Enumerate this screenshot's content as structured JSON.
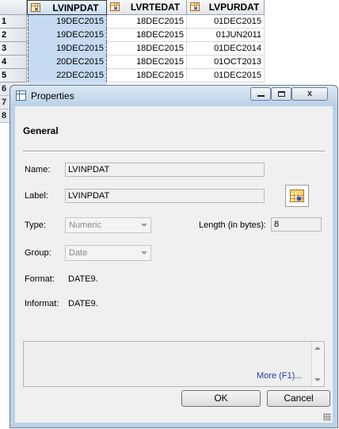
{
  "grid": {
    "columns": [
      "LVINPDAT",
      "LVRTEDAT",
      "LVPURDAT"
    ],
    "rows": [
      {
        "num": "1",
        "cells": [
          "19DEC2015",
          "18DEC2015",
          "01DEC2015"
        ]
      },
      {
        "num": "2",
        "cells": [
          "19DEC2015",
          "18DEC2015",
          "01JUN2011"
        ]
      },
      {
        "num": "3",
        "cells": [
          "19DEC2015",
          "18DEC2015",
          "01DEC2014"
        ]
      },
      {
        "num": "4",
        "cells": [
          "20DEC2015",
          "18DEC2015",
          "01OCT2013"
        ]
      },
      {
        "num": "5",
        "cells": [
          "22DEC2015",
          "18DEC2015",
          "01DEC2015"
        ]
      }
    ],
    "hidden_row_numbers": [
      "6",
      "7",
      "8"
    ],
    "column_icon": "table-column-icon"
  },
  "dialog": {
    "title": "Properties",
    "title_icon": "properties-icon",
    "section": "General",
    "name_label": "Name:",
    "name_value": "LVINPDAT",
    "label_label": "Label:",
    "label_value": "LVINPDAT",
    "type_label": "Type:",
    "type_value": "Numeric",
    "length_label": "Length (in bytes):",
    "length_value": "8",
    "group_label": "Group:",
    "group_value": "Date",
    "format_label": "Format:",
    "format_value": "DATE9.",
    "informat_label": "Informat:",
    "informat_value": "DATE9.",
    "more_link": "More (F1)...",
    "ok_label": "OK",
    "cancel_label": "Cancel",
    "close_glyph": "x",
    "column_type_icon": "numeric-column-icon"
  }
}
